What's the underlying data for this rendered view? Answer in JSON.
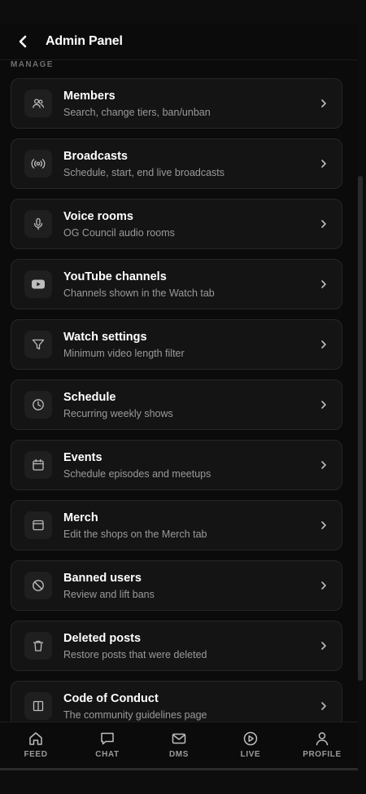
{
  "header": {
    "title": "Admin Panel",
    "back_icon": "chevron-left-icon"
  },
  "section": {
    "label": "MANAGE"
  },
  "items": [
    {
      "title": "Members",
      "subtitle": "Search, change tiers, ban/unban",
      "icon": "users-icon"
    },
    {
      "title": "Broadcasts",
      "subtitle": "Schedule, start, end live broadcasts",
      "icon": "broadcast-icon"
    },
    {
      "title": "Voice rooms",
      "subtitle": "OG Council audio rooms",
      "icon": "microphone-icon"
    },
    {
      "title": "YouTube channels",
      "subtitle": "Channels shown in the Watch tab",
      "icon": "youtube-icon"
    },
    {
      "title": "Watch settings",
      "subtitle": "Minimum video length filter",
      "icon": "filter-icon"
    },
    {
      "title": "Schedule",
      "subtitle": "Recurring weekly shows",
      "icon": "clock-icon"
    },
    {
      "title": "Events",
      "subtitle": "Schedule episodes and meetups",
      "icon": "calendar-icon"
    },
    {
      "title": "Merch",
      "subtitle": "Edit the shops on the Merch tab",
      "icon": "shop-window-icon"
    },
    {
      "title": "Banned users",
      "subtitle": "Review and lift bans",
      "icon": "ban-icon"
    },
    {
      "title": "Deleted posts",
      "subtitle": "Restore posts that were deleted",
      "icon": "trash-icon"
    },
    {
      "title": "Code of Conduct",
      "subtitle": "The community guidelines page",
      "icon": "book-icon"
    }
  ],
  "nav": [
    {
      "label": "FEED",
      "icon": "home-icon"
    },
    {
      "label": "CHAT",
      "icon": "chat-icon"
    },
    {
      "label": "DMS",
      "icon": "mail-icon"
    },
    {
      "label": "LIVE",
      "icon": "play-circle-icon"
    },
    {
      "label": "PROFILE",
      "icon": "user-icon"
    }
  ],
  "colors": {
    "background": "#0b0b0b",
    "card": "#141414",
    "card_border": "#262626",
    "subtitle": "#9a9a9a",
    "section_label": "#6f6f6f"
  }
}
